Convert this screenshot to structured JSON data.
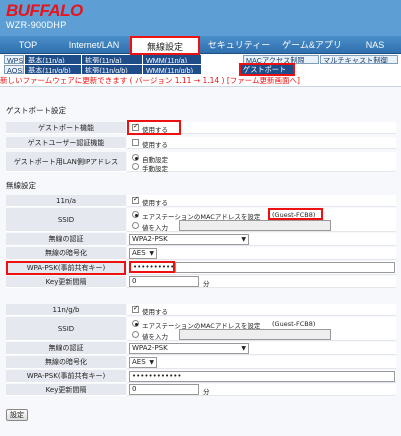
{
  "brand": {
    "logo": "BUFFALO",
    "model": "WZR-900DHP"
  },
  "nav": {
    "tabs": [
      {
        "label": "TOP"
      },
      {
        "label": "Internet/LAN"
      },
      {
        "label": "無線設定"
      },
      {
        "label": "セキュリティー"
      },
      {
        "label": "ゲーム&アプリ"
      },
      {
        "label": "NAS"
      }
    ],
    "active": "無線設定"
  },
  "subnav": {
    "row1": [
      "WPS",
      "基本(11n/a)",
      "拡張(11n/a)",
      "WMM(11n/a)",
      "MACアクセス制限",
      "マルチキャスト制御"
    ],
    "row2": [
      "AOSS",
      "基本(11n/g/b)",
      "拡張(11n/g/b)",
      "WMM(11n/g/b)",
      "ゲストポート"
    ]
  },
  "notice": "新しいファームウェアに更新できます ( バージョン 1.11 → 1.14 ) [ファーム更新画面へ]",
  "guest": {
    "title": "ゲストポート設定",
    "port_label": "ゲストポート機能",
    "port_value": "使用する",
    "auth_label": "ゲストユーザー認証機能",
    "auth_value": "使用する",
    "lanip_label": "ゲストポート用LAN側IPアドレス",
    "lanip_auto": "自動設定",
    "lanip_manual": "手動設定"
  },
  "wireless": {
    "title": "無線設定",
    "labels": {
      "ssid": "SSID",
      "auth": "無線の認証",
      "enc": "無線の暗号化",
      "psk": "WPA-PSK(事前共有キー)",
      "key_interval": "Key更新間隔",
      "use": "使用する",
      "ssid_mac": "エアステーションのMACアドレスを設定",
      "ssid_input": "値を入力",
      "minutes": "分"
    },
    "band_a": {
      "label": "11n/a",
      "ssid_value": "(Guest-FCB8)",
      "auth": "WPA2-PSK",
      "enc": "AES",
      "psk": "••••••••••••",
      "key_interval": "0"
    },
    "band_g": {
      "label": "11n/g/b",
      "ssid_value": "(Guest-FCB8)",
      "auth": "WPA2-PSK",
      "enc": "AES",
      "psk": "••••••••••••",
      "key_interval": "0"
    }
  },
  "submit_label": "設定"
}
